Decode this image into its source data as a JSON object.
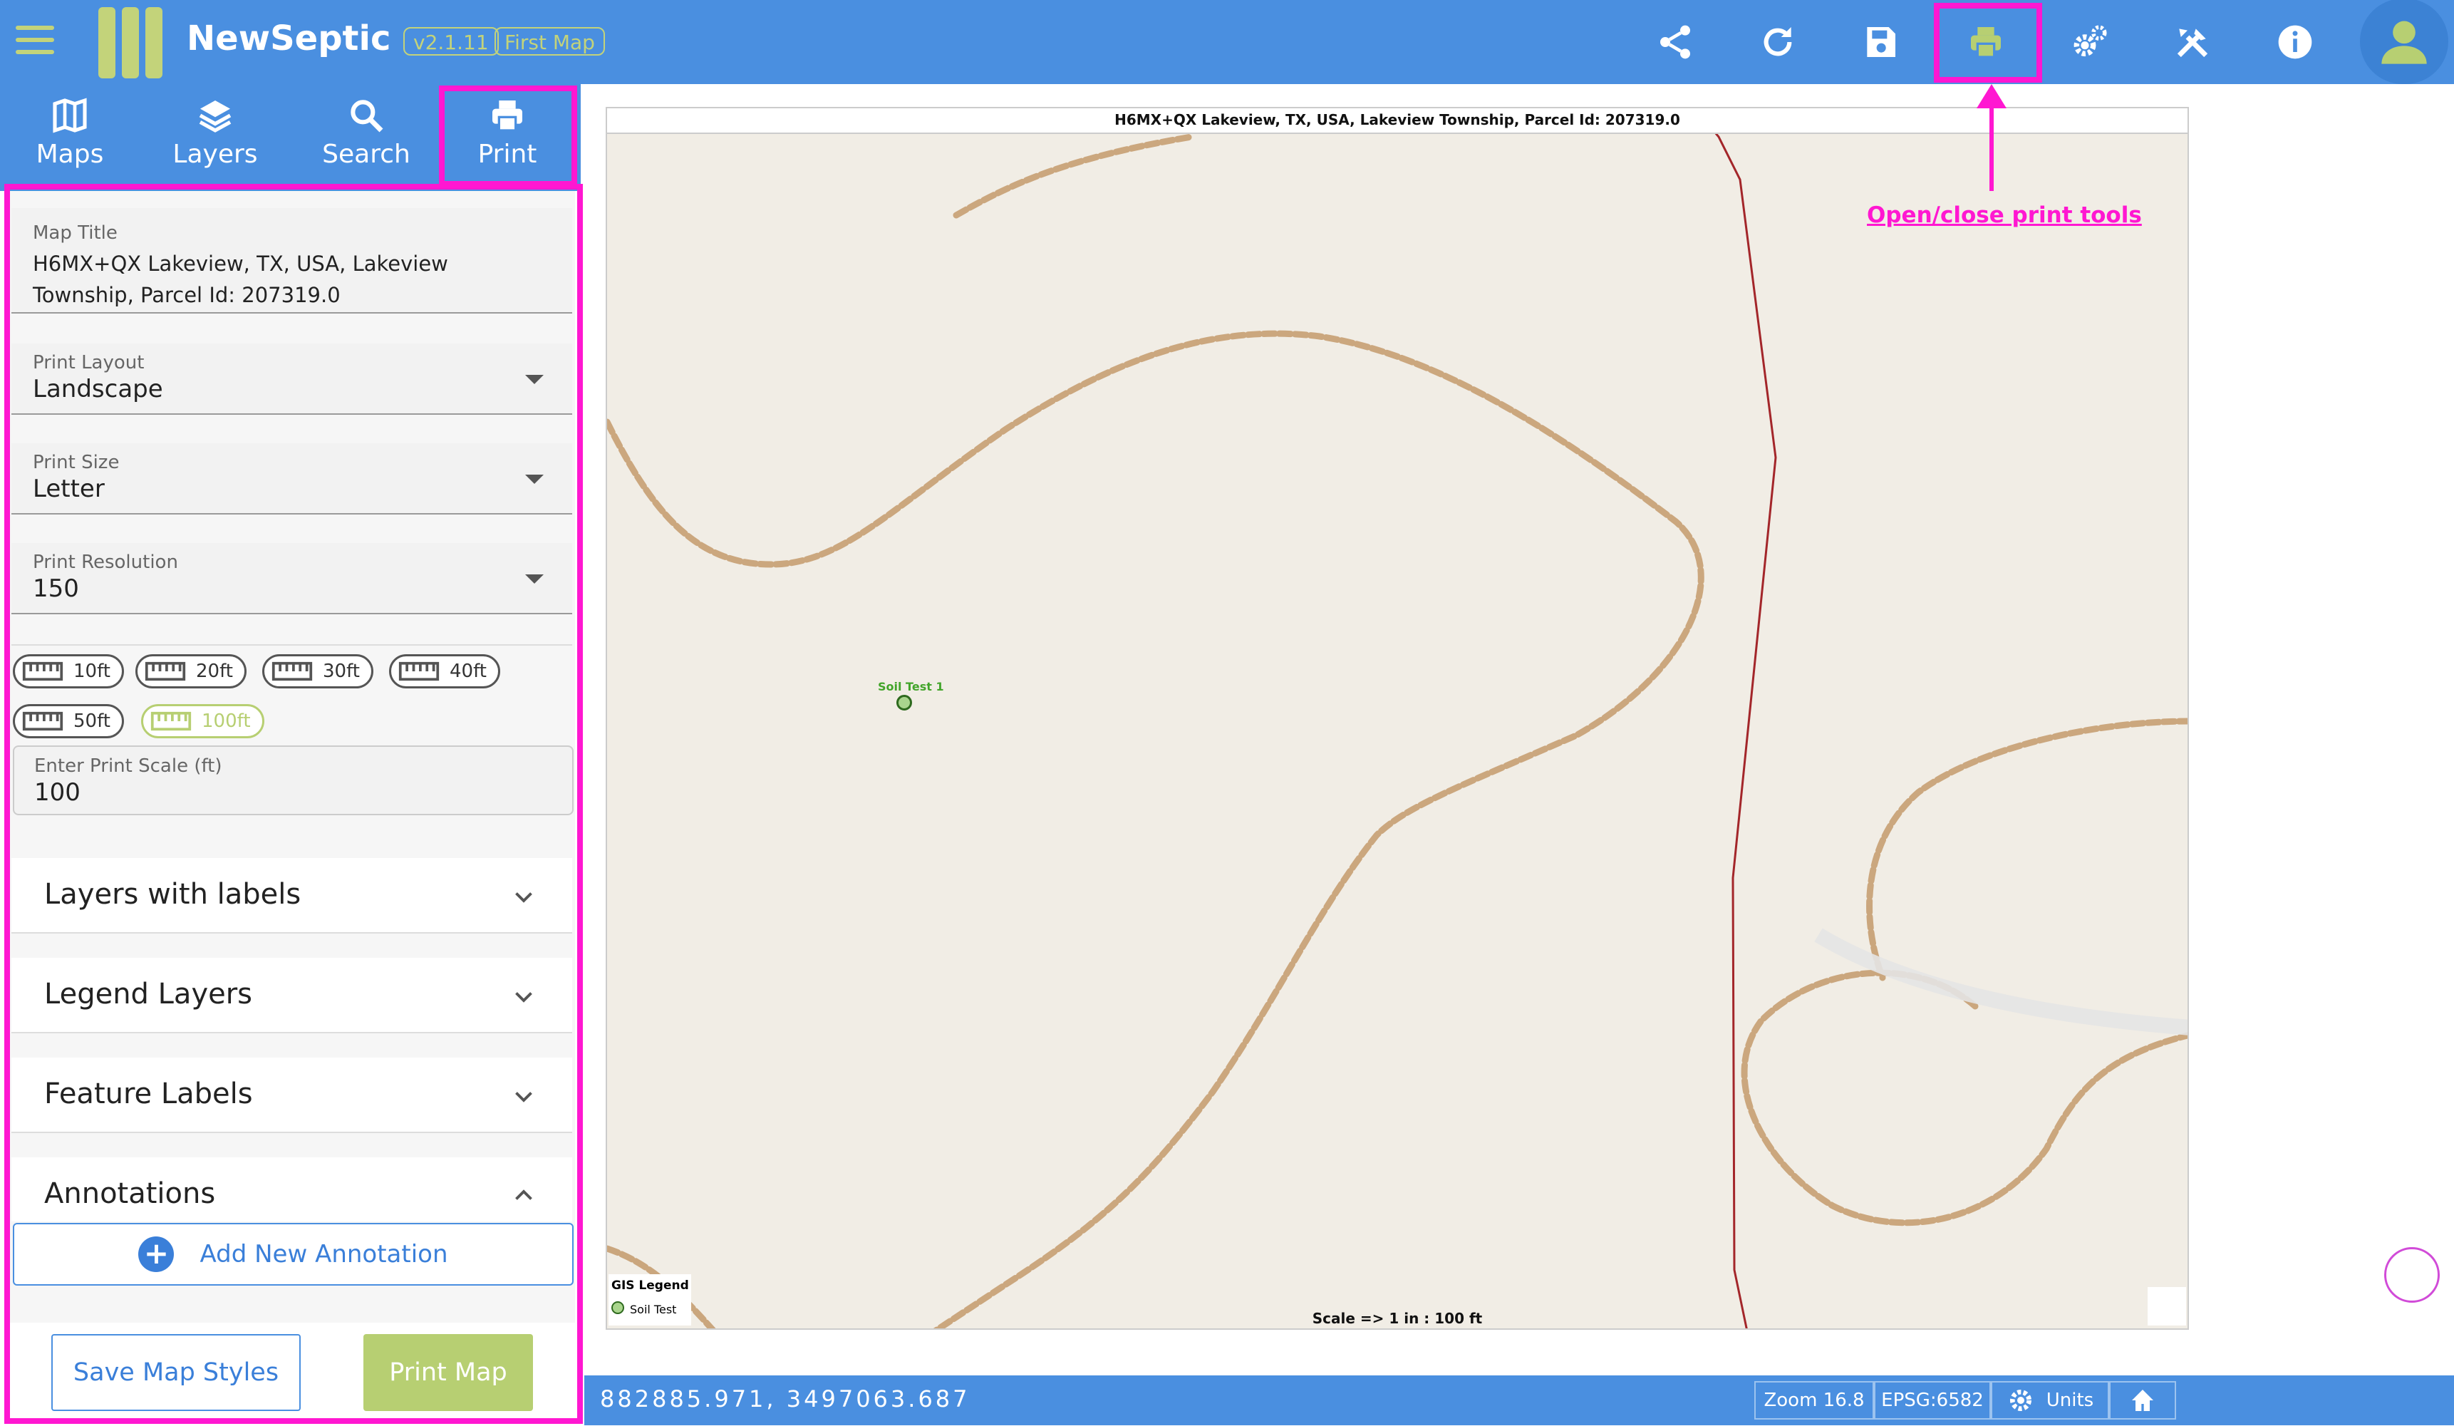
{
  "app": {
    "name": "NewSeptic",
    "version": "v2.1.11",
    "map_name": "First Map"
  },
  "toolbar": {
    "icons": [
      "share-icon",
      "refresh-icon",
      "save-icon",
      "print-icon",
      "settings-icon",
      "tools-icon",
      "info-icon",
      "user-icon"
    ]
  },
  "sidebar": {
    "tabs": [
      {
        "label": "Maps",
        "icon": "map-icon"
      },
      {
        "label": "Layers",
        "icon": "layers-icon"
      },
      {
        "label": "Search",
        "icon": "search-icon"
      },
      {
        "label": "Print",
        "icon": "print-icon",
        "active": true
      }
    ]
  },
  "print_panel": {
    "map_title_label": "Map Title",
    "map_title_value": "H6MX+QX Lakeview, TX, USA, Lakeview Township,  Parcel Id: 207319.0",
    "print_layout_label": "Print Layout",
    "print_layout_value": "Landscape",
    "print_size_label": "Print Size",
    "print_size_value": "Letter",
    "print_resolution_label": "Print Resolution",
    "print_resolution_value": "150",
    "scale_chips": [
      "10ft",
      "20ft",
      "30ft",
      "40ft",
      "50ft",
      "100ft"
    ],
    "scale_chip_selected": "100ft",
    "scale_input_label": "Enter Print Scale (ft)",
    "scale_input_value": "100",
    "sections": [
      {
        "title": "Layers with labels",
        "expanded": false
      },
      {
        "title": "Legend Layers",
        "expanded": false
      },
      {
        "title": "Feature Labels",
        "expanded": false
      },
      {
        "title": "Annotations",
        "expanded": true
      }
    ],
    "add_annotation_label": "Add New Annotation",
    "save_styles_label": "Save Map Styles",
    "print_map_label": "Print Map"
  },
  "map": {
    "title": "H6MX+QX Lakeview, TX, USA, Lakeview Township,  Parcel Id: 207319.0",
    "marker_label": "Soil Test 1",
    "legend_title": "GIS Legend",
    "legend_item": "Soil Test",
    "scale_text": "Scale => 1 in : 100 ft",
    "annotation": "Open/close print tools"
  },
  "status_bar": {
    "coordinates": "882885.971, 3497063.687",
    "zoom": "Zoom 16.8",
    "epsg": "EPSG:6582",
    "units": "Units"
  },
  "colors": {
    "primary": "#4a8fe0",
    "accent": "#b7cf72",
    "highlight": "#ff17d1"
  }
}
